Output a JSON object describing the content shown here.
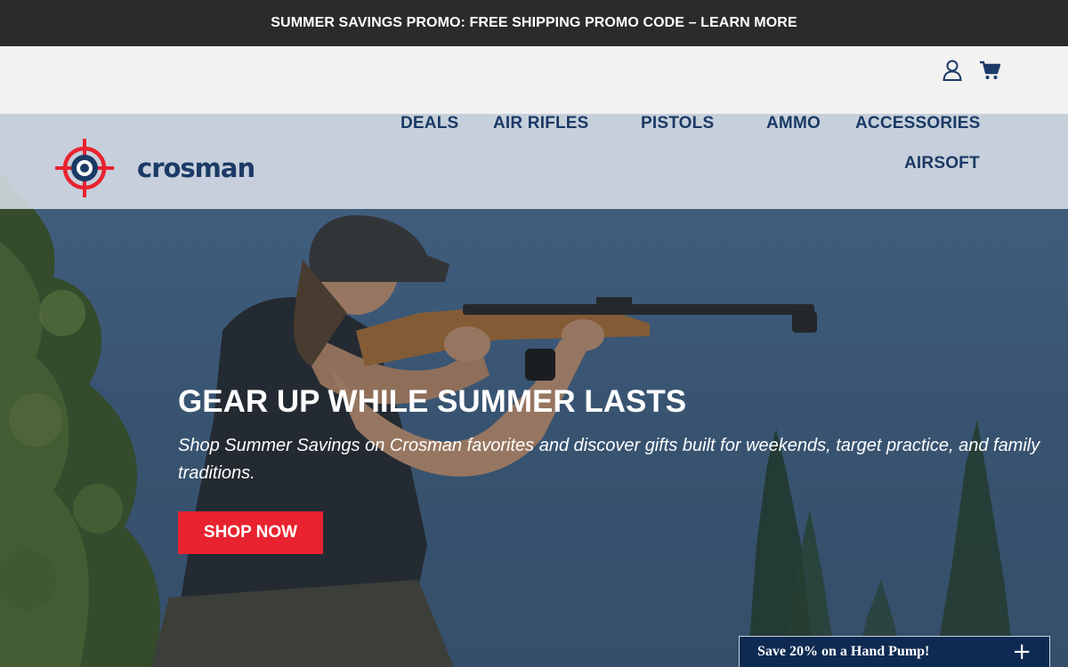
{
  "promo": {
    "text": "SUMMER SAVINGS PROMO: FREE SHIPPING PROMO CODE – LEARN MORE"
  },
  "brand": {
    "name": "crosman"
  },
  "header": {
    "icons": [
      "account-icon",
      "cart-icon"
    ]
  },
  "nav": {
    "deals": "DEALS",
    "air_rifles": "AIR RIFLES",
    "pistols": "PISTOLS",
    "ammo": "AMMO",
    "accessories": "ACCESSORIES",
    "airsoft": "AIRSOFT"
  },
  "hero": {
    "title": "GEAR UP WHILE SUMMER LASTS",
    "subtitle": "Shop Summer Savings on Crosman favorites and discover gifts built for weekends, target practice, and family traditions.",
    "cta": "SHOP NOW"
  },
  "popup": {
    "text": "Save 20% on a Hand Pump!",
    "toggle": "+"
  },
  "colors": {
    "navy": "#1b3a66",
    "red": "#e8232f",
    "dark": "#2b2b2b"
  }
}
